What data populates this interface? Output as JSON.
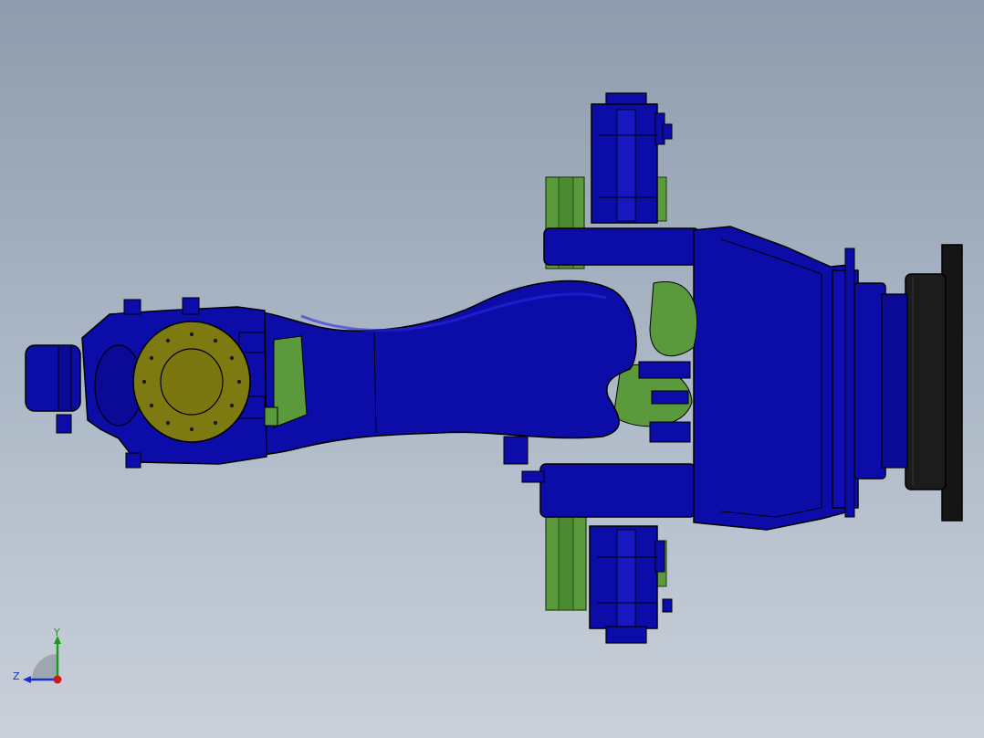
{
  "viewport": {
    "background_top": "#8f9cad",
    "background_bottom": "#c9d0da"
  },
  "model": {
    "colors": {
      "body": "#0c0ca8",
      "body_dark": "#050566",
      "body_light": "#1e1ecf",
      "flange": "#7d7a12",
      "green": "#5a9a3c",
      "green_dark": "#3c6e28",
      "black_base": "#151515"
    }
  },
  "triad": {
    "y_label": "Y",
    "z_label": "Z",
    "colors": {
      "y_axis": "#1a9a1a",
      "z_axis": "#1a2fd0",
      "x_axis": "#d01818"
    }
  }
}
